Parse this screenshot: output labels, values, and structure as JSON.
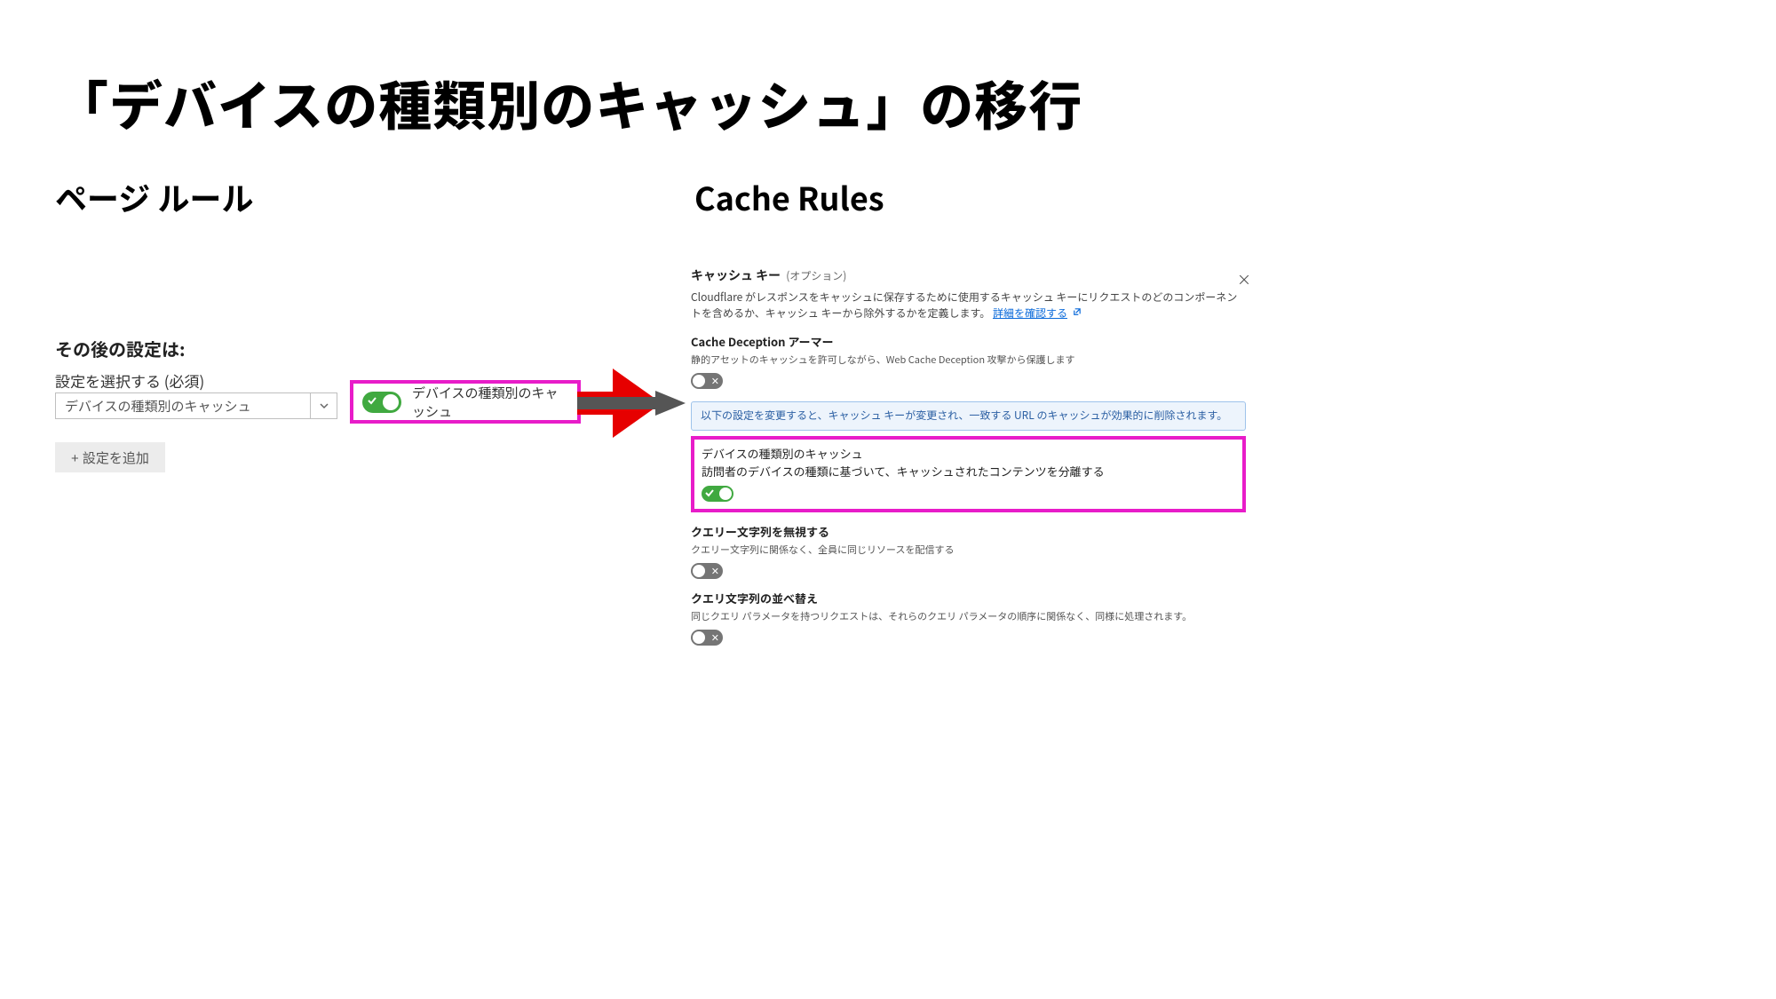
{
  "title": "「デバイスの種類別のキャッシュ」の移行",
  "left": {
    "heading": "ページ ルール",
    "after_settings_label": "その後の設定は:",
    "select_label": "設定を選択する (必須)",
    "select_value": "デバイスの種類別のキャッシュ",
    "add_setting_label": "+ 設定を追加",
    "toggle_card_label": "デバイスの種類別のキャッシュ"
  },
  "right": {
    "heading": "Cache Rules",
    "cache_key_title": "キャッシュ キー",
    "cache_key_optional": "(オプション)",
    "cache_key_desc_a": "Cloudflare がレスポンスをキャッシュに保存するために使用するキャッシュ キーにリクエストのどのコンポーネントを含めるか、キャッシュ キーから除外するかを定義します。",
    "link_text": "詳細を確認する",
    "cache_deception_title": "Cache Deception アーマー",
    "cache_deception_desc": "静的アセットのキャッシュを許可しながら、Web Cache Deception 攻撃から保護します",
    "notice": "以下の設定を変更すると、キャッシュ キーが変更され、一致する URL のキャッシュが効果的に削除されます。",
    "device_title": "デバイスの種類別のキャッシュ",
    "device_desc": "訪問者のデバイスの種類に基づいて、キャッシュされたコンテンツを分離する",
    "ignore_qs_title": "クエリー文字列を無視する",
    "ignore_qs_desc": "クエリー文字列に関係なく、全員に同じリソースを配信する",
    "sort_qs_title": "クエリ文字列の並べ替え",
    "sort_qs_desc": "同じクエリ パラメータを持つリクエストは、それらのクエリ パラメータの順序に関係なく、同様に処理されます。",
    "close_label": "×"
  }
}
